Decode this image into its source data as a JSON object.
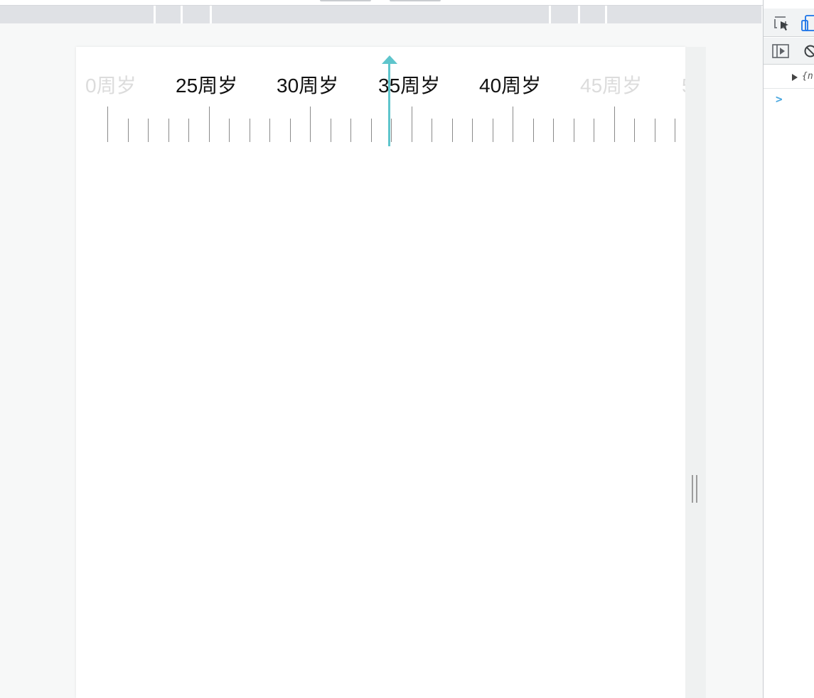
{
  "age_picker": {
    "labels": [
      {
        "text": "0周岁",
        "state": "faded"
      },
      {
        "text": "25周岁",
        "state": "normal"
      },
      {
        "text": "30周岁",
        "state": "normal"
      },
      {
        "text": "35周岁",
        "state": "normal"
      },
      {
        "text": "40周岁",
        "state": "normal"
      },
      {
        "text": "45周岁",
        "state": "faded"
      },
      {
        "text": "5",
        "state": "faded"
      }
    ],
    "indicator_color": "#5ec5cc",
    "selected_label": "35周岁"
  },
  "devtools": {
    "icons": [
      "inspect-element-icon",
      "device-toolbar-icon",
      "sidebar-toggle-icon",
      "clear-console-icon"
    ],
    "console_object_preview": "{n",
    "prompt_symbol": ">"
  },
  "colors": {
    "accent": "#5ec5cc",
    "ruler_bar": "#dfe1e5",
    "page_background": "#f7f8f8"
  }
}
